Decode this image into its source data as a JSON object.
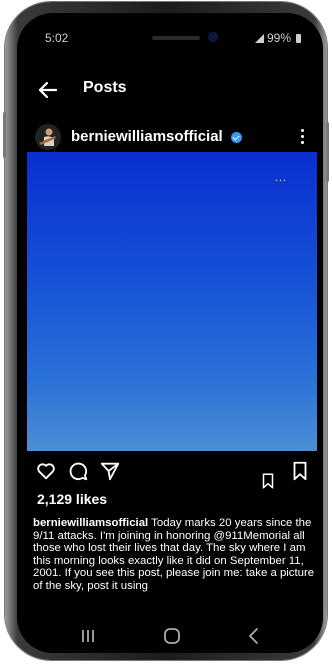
{
  "status": {
    "time": "5:02",
    "battery": "99%"
  },
  "appbar": {
    "title": "Posts"
  },
  "post": {
    "username": "berniewilliamsofficial",
    "image_overlay": "...",
    "likes": "2,129 likes",
    "caption_user": "berniewilliamsofficial",
    "caption_text": " Today marks 20 years since the 9/11 attacks. I'm joining in honoring @911Memorial all those who lost their lives that day. The sky where I am this morning looks exactly like it did on September 11, 2001. If you see this post, please join me: take a picture of the sky, post it using"
  },
  "colors": {
    "background": "#000000",
    "text": "#ffffff",
    "verified": "#3897f0",
    "sky_top": "#0a2fd0",
    "sky_bottom": "#4b8fd4"
  },
  "icons": [
    "back-arrow-icon",
    "verified-badge-icon",
    "more-vertical-icon",
    "more-horizontal-icon",
    "heart-icon",
    "comment-icon",
    "share-icon",
    "bookmark-icon",
    "recents-icon",
    "home-icon",
    "back-nav-icon"
  ]
}
